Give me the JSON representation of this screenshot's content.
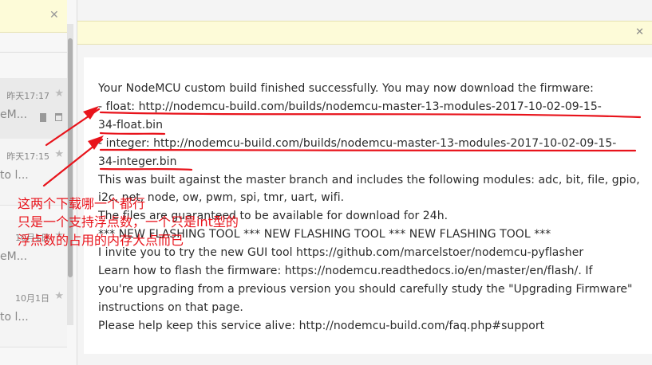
{
  "left_pane": {
    "notice_close": "✕",
    "items": [
      {
        "date": "昨天17:17",
        "snippet": "eM..."
      },
      {
        "date": "昨天17:15",
        "snippet": "to l..."
      },
      {
        "date": "10月1日",
        "snippet": "eM..."
      },
      {
        "date": "10月1日",
        "snippet": "to l..."
      }
    ]
  },
  "reading_pane": {
    "notice_close": "✕",
    "message": {
      "intro": "Your NodeMCU custom build finished successfully. You may now download the firmware:",
      "float_line1": "- float: http://nodemcu-build.com/builds/nodemcu-master-13-modules-2017-10-02-09-15-",
      "float_line2": "34-float.bin",
      "integer_line1": "- integer: http://nodemcu-build.com/builds/nodemcu-master-13-modules-2017-10-02-09-15-",
      "integer_line2": "34-integer.bin",
      "built_line1": "This was built against the master branch and includes the following modules: adc, bit, file, gpio,",
      "built_line2": "i2c, net, node, ow, pwm, spi, tmr, uart, wifi.",
      "availability": "The files are guaranteed to be available for download for 24h.",
      "new_tool": "*** NEW FLASHING TOOL *** NEW FLASHING TOOL *** NEW FLASHING TOOL ***",
      "invite": "I invite you to try the new GUI tool https://github.com/marcelstoer/nodemcu-pyflasher",
      "learn_line1": "Learn how to flash the firmware: https://nodemcu.readthedocs.io/en/master/en/flash/. If",
      "learn_line2": "you're upgrading from a previous version you should carefully study the \"Upgrading Firmware\"",
      "learn_line3": "instructions on that page.",
      "support": "Please help keep this service alive: http://nodemcu-build.com/faq.php#support"
    }
  },
  "annotation": {
    "lines": [
      "这两个下载哪一个都行",
      "只是一个支持浮点数，一个只是int型的",
      "浮点数的占用的内存大点而已"
    ],
    "color": "#e8131b"
  },
  "icons": {
    "star": "star-icon",
    "flag": "flag-icon",
    "trash": "trash-icon",
    "close": "close-icon"
  }
}
